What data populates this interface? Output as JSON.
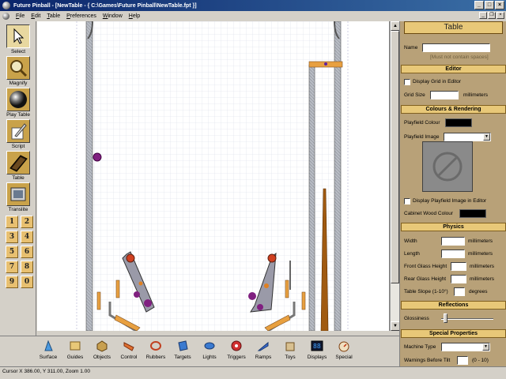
{
  "window": {
    "title": "Future Pinball - [NewTable - { C:\\Games\\Future Pinball\\NewTable.fpt }]"
  },
  "menu": {
    "items": [
      {
        "label": "File",
        "key": "F",
        "rest": "ile"
      },
      {
        "label": "Edit",
        "key": "E",
        "rest": "dit"
      },
      {
        "label": "Table",
        "key": "T",
        "rest": "able"
      },
      {
        "label": "Preferences",
        "key": "P",
        "rest": "references"
      },
      {
        "label": "Window",
        "key": "W",
        "rest": "indow"
      },
      {
        "label": "Help",
        "key": "H",
        "rest": "elp"
      }
    ]
  },
  "left_tools": {
    "select": "Select",
    "magnify": "Magnify",
    "play_table": "Play Table",
    "script": "Script",
    "table": "Table",
    "translite": "Translite",
    "numbers": [
      "1",
      "2",
      "3",
      "4",
      "5",
      "6",
      "7",
      "8",
      "9",
      "0"
    ]
  },
  "bottom_tools": [
    "Surface",
    "Guides",
    "Objects",
    "Control",
    "Rubbers",
    "Targets",
    "Lights",
    "Triggers",
    "Ramps",
    "Toys",
    "Displays",
    "Special"
  ],
  "properties": {
    "title": "Table",
    "name_label": "Name",
    "name_value": "",
    "name_hint": "[Must not contain spaces]",
    "editor_header": "Editor",
    "display_grid": "Display Grid in Editor",
    "grid_size_label": "Grid Size",
    "grid_size_value": "",
    "grid_units": "millimeters",
    "colours_header": "Colours & Rendering",
    "playfield_colour": "Playfield Colour",
    "playfield_image": "Playfield Image",
    "playfield_image_value": "",
    "display_playfield_image": "Display Playfield Image in Editor",
    "cabinet_wood_colour": "Cabinet Wood Colour",
    "physics_header": "Physics",
    "width_label": "Width",
    "length_label": "Length",
    "front_glass_label": "Front Glass Height",
    "rear_glass_label": "Rear Glass Height",
    "units": "millimeters",
    "table_slope_label": "Table Slope (1-10°)",
    "degrees": "degrees",
    "reflections_header": "Reflections",
    "glossiness_label": "Glossiness",
    "special_header": "Special Properties",
    "machine_type_label": "Machine Type",
    "machine_type_value": "",
    "warnings_label": "Warnings Before Tilt",
    "warnings_range": "(0 - 10)"
  },
  "colors": {
    "playfield_colour": "#000000",
    "cabinet_wood_colour": "#000000"
  },
  "status": {
    "text": "Cursor X 386.00, Y 311.00, Zoom 1.00"
  }
}
